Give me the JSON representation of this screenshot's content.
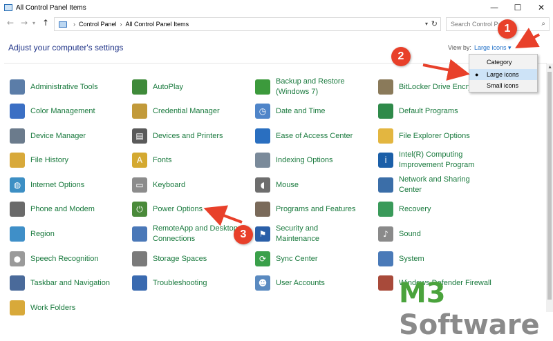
{
  "window": {
    "title": "All Control Panel Items",
    "minimize": "—",
    "maximize": "☐",
    "close": "✕"
  },
  "addressbar": {
    "breadcrumbs": [
      "Control Panel",
      "All Control Panel Items"
    ],
    "separator": "›",
    "search_placeholder": "Search Control Panel"
  },
  "header": {
    "heading": "Adjust your computer's settings",
    "view_by_label": "View by:",
    "view_by_value": "Large icons ▾"
  },
  "view_menu": {
    "options": [
      "Category",
      "Large icons",
      "Small icons"
    ],
    "selected": "Large icons",
    "bullet": "●"
  },
  "items": [
    {
      "label": "Administrative Tools",
      "icon": "admin-tools-icon",
      "color": "#5b7da8"
    },
    {
      "label": "AutoPlay",
      "icon": "autoplay-icon",
      "color": "#3f8a3a"
    },
    {
      "label": "Backup and Restore (Windows 7)",
      "icon": "backup-icon",
      "color": "#3c9a3c"
    },
    {
      "label": "BitLocker Drive Encry",
      "icon": "bitlocker-icon",
      "color": "#8a7a5a"
    },
    {
      "label": "Color Management",
      "icon": "color-management-icon",
      "color": "#3b6fc4"
    },
    {
      "label": "Credential Manager",
      "icon": "credential-icon",
      "color": "#c29a3a"
    },
    {
      "label": "Date and Time",
      "icon": "clock-icon",
      "color": "#4f85c9"
    },
    {
      "label": "Default Programs",
      "icon": "default-programs-icon",
      "color": "#2f8a4a"
    },
    {
      "label": "Device Manager",
      "icon": "device-manager-icon",
      "color": "#6b7b8c"
    },
    {
      "label": "Devices and Printers",
      "icon": "printer-icon",
      "color": "#5a5a5a"
    },
    {
      "label": "Ease of Access Center",
      "icon": "ease-of-access-icon",
      "color": "#2a6fc0"
    },
    {
      "label": "File Explorer Options",
      "icon": "folder-options-icon",
      "color": "#e3b640"
    },
    {
      "label": "File History",
      "icon": "file-history-icon",
      "color": "#d8a93a"
    },
    {
      "label": "Fonts",
      "icon": "fonts-icon",
      "color": "#d4a930"
    },
    {
      "label": "Indexing Options",
      "icon": "indexing-icon",
      "color": "#7a8a9a"
    },
    {
      "label": "Intel(R) Computing Improvement Program",
      "icon": "intel-icon",
      "color": "#1b5fa8"
    },
    {
      "label": "Internet Options",
      "icon": "globe-icon",
      "color": "#3d8fc4"
    },
    {
      "label": "Keyboard",
      "icon": "keyboard-icon",
      "color": "#8c8c8c"
    },
    {
      "label": "Mouse",
      "icon": "mouse-icon",
      "color": "#6e6e6e"
    },
    {
      "label": "Network and Sharing Center",
      "icon": "network-icon",
      "color": "#3b6ea8"
    },
    {
      "label": "Phone and Modem",
      "icon": "phone-icon",
      "color": "#6a6a6a"
    },
    {
      "label": "Power Options",
      "icon": "power-icon",
      "color": "#4a8a3a"
    },
    {
      "label": "Programs and Features",
      "icon": "programs-icon",
      "color": "#7a6a5a"
    },
    {
      "label": "Recovery",
      "icon": "recovery-icon",
      "color": "#3a9a5a"
    },
    {
      "label": "Region",
      "icon": "region-icon",
      "color": "#3f8fc8"
    },
    {
      "label": "RemoteApp and Desktop Connections",
      "icon": "remoteapp-icon",
      "color": "#4a78b8"
    },
    {
      "label": "Security and Maintenance",
      "icon": "flag-icon",
      "color": "#2a5fa8"
    },
    {
      "label": "Sound",
      "icon": "speaker-icon",
      "color": "#8a8a8a"
    },
    {
      "label": "Speech Recognition",
      "icon": "microphone-icon",
      "color": "#9a9a9a"
    },
    {
      "label": "Storage Spaces",
      "icon": "storage-icon",
      "color": "#7a7a7a"
    },
    {
      "label": "Sync Center",
      "icon": "sync-icon",
      "color": "#3aa04a"
    },
    {
      "label": "System",
      "icon": "system-icon",
      "color": "#4a7ab8"
    },
    {
      "label": "Taskbar and Navigation",
      "icon": "taskbar-icon",
      "color": "#4a6a9a"
    },
    {
      "label": "Troubleshooting",
      "icon": "troubleshoot-icon",
      "color": "#3a6ab0"
    },
    {
      "label": "User Accounts",
      "icon": "users-icon",
      "color": "#5a8ac0"
    },
    {
      "label": "Windows Defender Firewall",
      "icon": "firewall-icon",
      "color": "#a84a3a"
    },
    {
      "label": "Work Folders",
      "icon": "work-folders-icon",
      "color": "#d8a93a"
    }
  ],
  "annotations": {
    "markers": [
      "1",
      "2",
      "3"
    ],
    "arrow_color": "#e8402a"
  },
  "watermark": {
    "part1": "M3 ",
    "part2": "Software"
  }
}
